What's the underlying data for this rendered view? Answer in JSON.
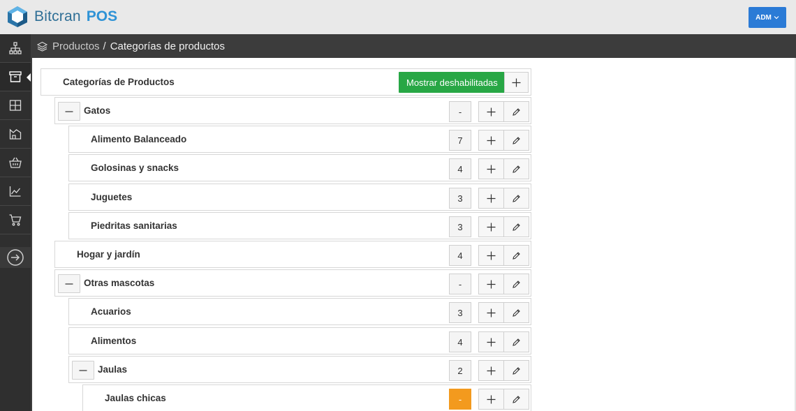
{
  "brand": {
    "name": "Bitcran",
    "product": "POS"
  },
  "user_menu": {
    "label": "ADM"
  },
  "breadcrumb": {
    "parent": "Productos",
    "separator": "/",
    "current": "Categorías de productos"
  },
  "panel": {
    "title": "Categorías de Productos",
    "show_disabled_label": "Mostrar deshabilitadas"
  },
  "sidebar": {
    "items": [
      {
        "name": "sitemap-icon"
      },
      {
        "name": "archive-icon",
        "active": true
      },
      {
        "name": "grid-icon"
      },
      {
        "name": "warehouse-icon"
      },
      {
        "name": "basket-icon"
      },
      {
        "name": "chart-line-icon"
      },
      {
        "name": "cart-icon"
      }
    ],
    "exit": {
      "name": "arrow-circle-right-icon"
    }
  },
  "categories": [
    {
      "label": "Gatos",
      "count": "-",
      "level": 1,
      "expanded": true
    },
    {
      "label": "Alimento Balanceado",
      "count": "7",
      "level": 2
    },
    {
      "label": "Golosinas y snacks",
      "count": "4",
      "level": 2
    },
    {
      "label": "Juguetes",
      "count": "3",
      "level": 2
    },
    {
      "label": "Piedritas sanitarias",
      "count": "3",
      "level": 2
    },
    {
      "label": "Hogar y jardín",
      "count": "4",
      "level": 1
    },
    {
      "label": "Otras mascotas",
      "count": "-",
      "level": 1,
      "expanded": true
    },
    {
      "label": "Acuarios",
      "count": "3",
      "level": 2
    },
    {
      "label": "Alimentos",
      "count": "4",
      "level": 2
    },
    {
      "label": "Jaulas",
      "count": "2",
      "level": 2,
      "expanded": true
    },
    {
      "label": "Jaulas chicas",
      "count": "-",
      "level": 3,
      "highlight": true
    }
  ],
  "colors": {
    "accent": "#2b7bd6",
    "success": "#28a745",
    "warning": "#f39a1e",
    "sidebar": "#2f2f2f"
  }
}
